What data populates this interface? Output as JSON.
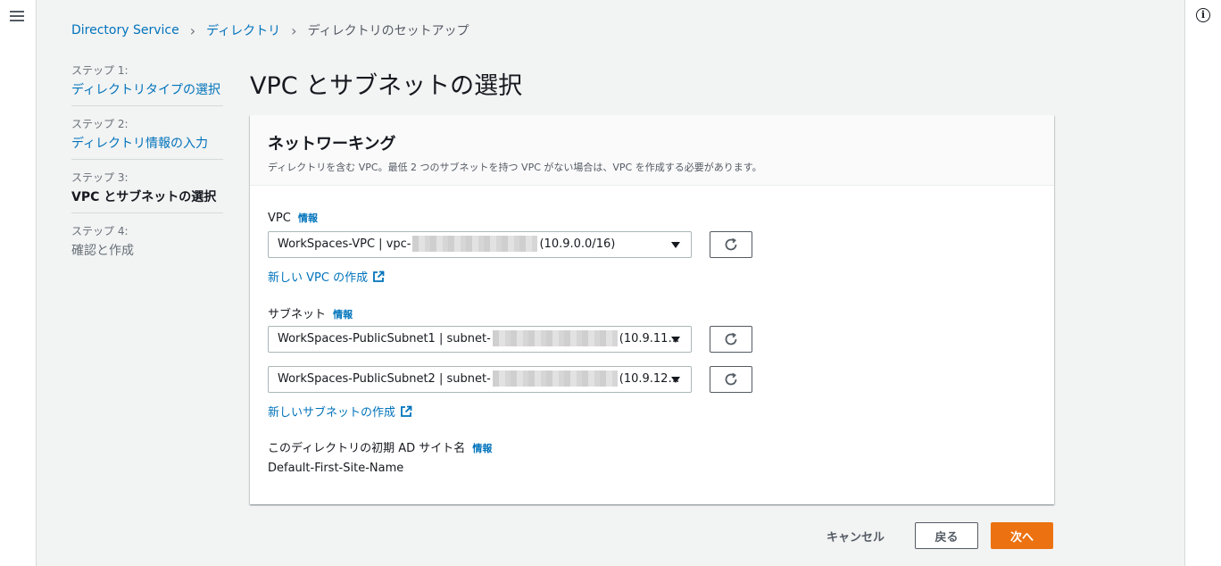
{
  "breadcrumb": {
    "items": [
      "Directory Service",
      "ディレクトリ"
    ],
    "current": "ディレクトリのセットアップ"
  },
  "steps": [
    {
      "number": "ステップ 1:",
      "label": "ディレクトリタイプの選択"
    },
    {
      "number": "ステップ 2:",
      "label": "ディレクトリ情報の入力"
    },
    {
      "number": "ステップ 3:",
      "label": "VPC とサブネットの選択"
    },
    {
      "number": "ステップ 4:",
      "label": "確認と作成"
    }
  ],
  "page_title": "VPC とサブネットの選択",
  "panel": {
    "title": "ネットワーキング",
    "description": "ディレクトリを含む VPC。最低 2 つのサブネットを持つ VPC がない場合は、VPC を作成する必要があります。",
    "vpc_label": "VPC",
    "info": "情報",
    "vpc_select": {
      "prefix": "WorkSpaces-VPC | vpc-",
      "suffix": "(10.9.0.0/16)"
    },
    "new_vpc_link": "新しい VPC の作成",
    "subnet_label": "サブネット",
    "subnet1": {
      "prefix": "WorkSpaces-PublicSubnet1 | subnet-",
      "suffix": "(10.9.11…"
    },
    "subnet2": {
      "prefix": "WorkSpaces-PublicSubnet2 | subnet-",
      "suffix": "(10.9.12…"
    },
    "new_subnet_link": "新しいサブネットの作成",
    "site_label": "このディレクトリの初期 AD サイト名",
    "site_value": "Default-First-Site-Name"
  },
  "actions": {
    "cancel": "キャンセル",
    "back": "戻る",
    "next": "次へ"
  },
  "colors": {
    "link": "#0073bb",
    "primary": "#ec7211"
  },
  "icons": {
    "menu": "hamburger-menu-icon",
    "help": "info-icon",
    "refresh": "refresh-icon",
    "external": "external-link-icon"
  }
}
